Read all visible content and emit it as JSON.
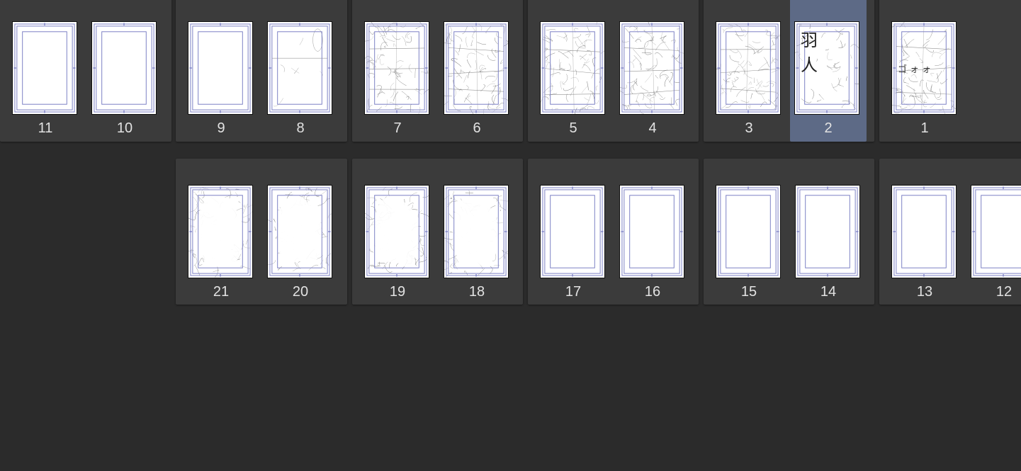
{
  "app": {
    "view": "page-manager-thumbnails"
  },
  "colors": {
    "background": "#2b2b2b",
    "spread_background": "#3b3b3b",
    "selected_highlight": "#5d6a86",
    "guide_frame": "#7b7fc4",
    "page_number": "#e2e2e2"
  },
  "rows": [
    {
      "spreads": [
        {
          "pages": [
            {
              "number": "11",
              "content": "blank"
            },
            {
              "number": "10",
              "content": "blank"
            }
          ]
        },
        {
          "pages": [
            {
              "number": "9",
              "content": "blank"
            },
            {
              "number": "8",
              "content": "light-sketch"
            }
          ]
        },
        {
          "pages": [
            {
              "number": "7",
              "content": "sketch"
            },
            {
              "number": "6",
              "content": "sketch"
            }
          ]
        },
        {
          "pages": [
            {
              "number": "5",
              "content": "sketch"
            },
            {
              "number": "4",
              "content": "sketch"
            }
          ]
        },
        {
          "pages": [
            {
              "number": "3",
              "content": "sketch"
            },
            {
              "number": "2",
              "content": "title-sketch",
              "selected": true,
              "title_glyphs": "羽 人"
            }
          ]
        },
        {
          "pages": [
            {
              "number": "1",
              "content": "sketch",
              "sfx": "ゴォォ"
            }
          ]
        }
      ]
    },
    {
      "spreads": [
        {
          "pages": [
            {
              "number": "21",
              "content": "erased-sketch"
            },
            {
              "number": "20",
              "content": "erased-sketch"
            }
          ]
        },
        {
          "pages": [
            {
              "number": "19",
              "content": "erased-sketch"
            },
            {
              "number": "18",
              "content": "erased-sketch"
            }
          ]
        },
        {
          "pages": [
            {
              "number": "17",
              "content": "blank"
            },
            {
              "number": "16",
              "content": "blank"
            }
          ]
        },
        {
          "pages": [
            {
              "number": "15",
              "content": "blank"
            },
            {
              "number": "14",
              "content": "blank"
            }
          ]
        },
        {
          "pages": [
            {
              "number": "13",
              "content": "blank"
            },
            {
              "number": "12",
              "content": "blank"
            }
          ]
        }
      ]
    }
  ]
}
